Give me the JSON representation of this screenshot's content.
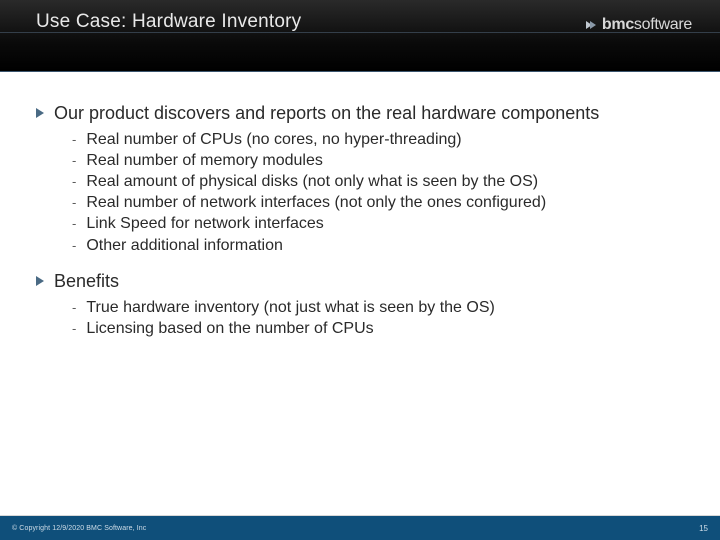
{
  "header": {
    "title": "Use Case: Hardware Inventory",
    "logo_bold": "bmc",
    "logo_light": "software"
  },
  "body": {
    "b1": {
      "text": "Our product discovers and reports on the real hardware components",
      "sub": [
        "Real number of CPUs (no cores, no hyper-threading)",
        "Real number of memory modules",
        "Real amount of physical disks (not only what is seen by the OS)",
        "Real number of network interfaces (not only the ones configured)",
        "Link Speed for network interfaces",
        "Other additional information"
      ]
    },
    "b2": {
      "text": "Benefits",
      "sub": [
        "True hardware inventory (not just what is seen by the OS)",
        "Licensing based on the number of CPUs"
      ]
    }
  },
  "footer": {
    "copyright": "© Copyright 12/9/2020 BMC Software, Inc",
    "page": "15"
  }
}
